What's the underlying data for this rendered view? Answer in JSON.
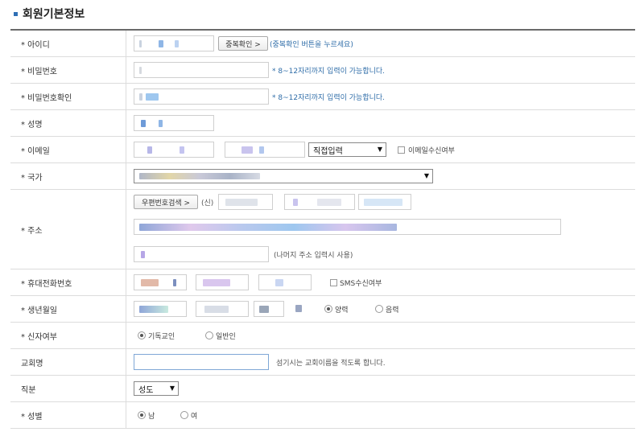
{
  "section_title": "회원기본정보",
  "rows": {
    "id": {
      "label": "* 아이디",
      "check_button": "중복확인 >",
      "hint": "(중복확인 버튼을 누르세요)"
    },
    "password": {
      "label": "* 비밀번호",
      "hint": "* 8~12자리까지 입력이 가능합니다."
    },
    "password_confirm": {
      "label": "* 비밀번호확인",
      "hint": "* 8~12자리까지 입력이 가능합니다."
    },
    "name": {
      "label": "* 성명"
    },
    "email": {
      "label": "* 이메일",
      "domain_select": "직접입력",
      "receive_label": "이메일수신여부"
    },
    "country": {
      "label": "* 국가"
    },
    "address": {
      "label": "* 주소",
      "zip_button": "우편번호검색 >",
      "new_label": "(신)",
      "rest_note": "(나머지 주소 입력시 사용)"
    },
    "mobile": {
      "label": "* 휴대전화번호",
      "sms_label": "SMS수신여부"
    },
    "birth": {
      "label": "* 생년월일",
      "solar": "양력",
      "lunar": "음력"
    },
    "faith": {
      "label": "* 신자여부",
      "christian": "기독교인",
      "general": "일반인"
    },
    "church": {
      "label": "교회명",
      "hint": "섬기시는 교회이름을 적도록 합니다."
    },
    "position": {
      "label": "직분",
      "selected": "성도"
    },
    "gender": {
      "label": "* 성별",
      "male": "남",
      "female": "여"
    }
  }
}
